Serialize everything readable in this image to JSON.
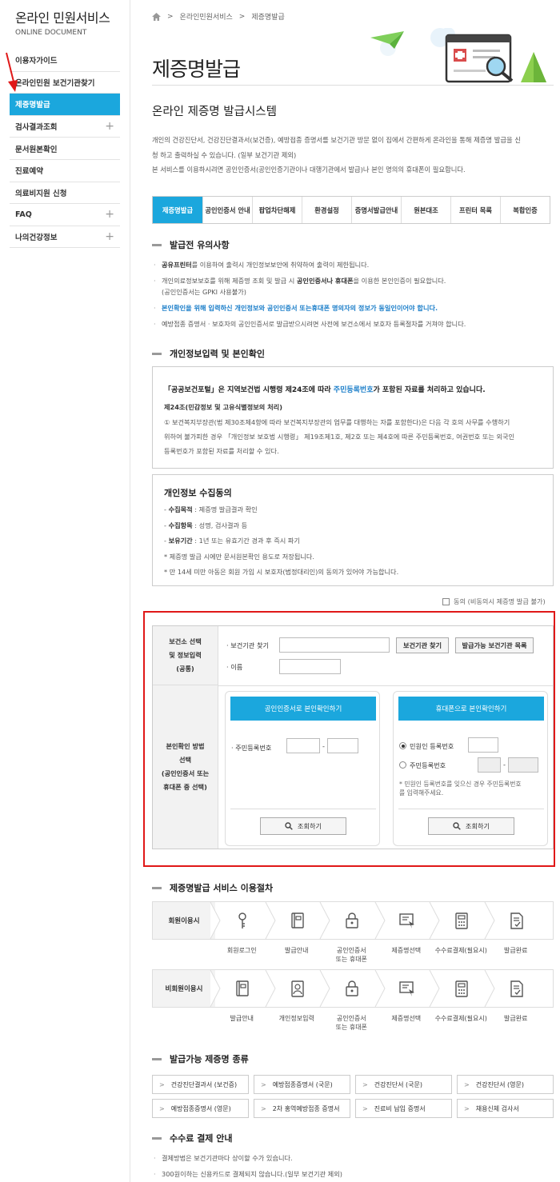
{
  "sidebar": {
    "title": "온라인 민원서비스",
    "subtitle": "ONLINE DOCUMENT",
    "items": [
      {
        "label": "이용자가이드",
        "plus": false,
        "active": false
      },
      {
        "label": "온라인민원 보건기관찾기",
        "plus": false,
        "active": false
      },
      {
        "label": "제증명발급",
        "plus": false,
        "active": true
      },
      {
        "label": "검사결과조회",
        "plus": true,
        "active": false
      },
      {
        "label": "문서원본확인",
        "plus": false,
        "active": false
      },
      {
        "label": "진료예약",
        "plus": false,
        "active": false
      },
      {
        "label": "의료비지원 신청",
        "plus": false,
        "active": false
      },
      {
        "label": "FAQ",
        "plus": true,
        "active": false
      },
      {
        "label": "나의건강정보",
        "plus": true,
        "active": false
      }
    ],
    "plus_symbol": "+"
  },
  "breadcrumb": {
    "home_icon": "home-icon",
    "sep": ">",
    "level1": "온라인민원서비스",
    "level2": "제증명발급"
  },
  "page_title": "제증명발급",
  "system_title": "온라인 제증명 발급시스템",
  "intro": {
    "line1": "개인의 건강진단서, 건강진단결과서(보건증), 예방접종 증명서를 보건기관 방문 없이 집에서 간편하게 온라인을 통해 제증명 발급을 신",
    "line2": "청 하고 출력하실 수 있습니다. (일부 보건기관 제외)",
    "line3": "본 서비스를 이용하시려면 공인인증서(공인인증기관이나 대행기관에서 발급)나 본인 명의의 휴대폰이 필요합니다."
  },
  "tabs": [
    "제증명발급",
    "공인인증서 안내",
    "팝업차단해제",
    "환경설정",
    "증명서발급안내",
    "원본대조",
    "프린터 목록",
    "복합인증"
  ],
  "notice": {
    "heading": "발급전 유의사항",
    "b1_bold": "공유프린터",
    "b1_rest": "를 이용하여 출력시 개인정보보안에 취약하여 출력이 제한됩니다.",
    "b2_pre": "개인의료정보보호를 위해 제증명 조회 및 발급 시 ",
    "b2_bold": "공인인증서나 휴대폰",
    "b2_post": "을 이용한 본인인증이 필요합니다.",
    "b2_line2": "(공인인증서는 GPKI 사용불가)",
    "b3": "본인확인을 위해 입력하신 개인정보와 공인인증서 또는휴대폰 명의자의 정보가 동일인이어야 합니다.",
    "b4": "예방접종 증명서 · 보호자의 공인인증서로 발급받으시려면 사전에 보건소에서 보호자 등록절차를 거쳐야 합니다."
  },
  "personal": {
    "heading": "개인정보입력 및 본인확인",
    "lead_pre": "「공공보건포털」은 지역보건법 시행령 제24조에 따라 ",
    "lead_link": "주민등록번호",
    "lead_post": "가 포함된 자료를 처리하고 있습니다.",
    "article": "제24조(민감정보 및 고유식별정보의 처리)",
    "art_l1": "① 보건복지부장관(법 제30조제4항에 따라 보건복지부장관의 업무를 대행하는 자를 포함한다)은 다음 각 호의 사무를 수행하기",
    "art_l2": "위하여 불가피한 경우 「개인정보 보호법 시행령」 제19조제1호, 제2호 또는 제4호에 따른 주민등록번호, 여권번호 또는 외국인",
    "art_l3": "등록번호가 포함된 자료를 처리할 수 있다."
  },
  "consent": {
    "title": "개인정보 수집동의",
    "purpose_label": "수집목적",
    "purpose": " : 제증명 발급결과 확인",
    "items_label": "수집항목",
    "items": " : 성명, 검사결과 등",
    "period_label": "보유기간",
    "period": " : 1년 또는 유효기간 경과 후 즉시 파기",
    "note1": "* 제증명 발급 시에만 문서원본확인 용도로 저장됩니다.",
    "note2": "* 만 14세 미만 아동은 회원 가입 시 보호자(법정대리인)의 동의가 있어야 가능합니다.",
    "agree": "동의 (비동의시 제증명 발급 불가)"
  },
  "form": {
    "row1_l1": "보건소 선택",
    "row1_l2": "및 정보입력",
    "row1_l3": "(공통)",
    "find_label": "· 보건기관 찾기",
    "find_btn": "보건기관 찾기",
    "list_btn": "발급가능 보건기관 목록",
    "name_label": "· 이름",
    "row2_l1": "본인확인 방법",
    "row2_l2": "선택",
    "row2_l3": "(공인인증서 또는",
    "row2_l4": "휴대폰 중 선택)",
    "cert_btn": "공인인증서로 본인확인하기",
    "rrn_label": "· 주민등록번호",
    "dash": "-",
    "phone_btn": "휴대폰으로 본인확인하기",
    "civil_reg": "민원인 등록번호",
    "rrn2": "주민등록번호",
    "phone_note1": "* 민원인 등록번호를 잊으신 경우 주민등록번호",
    "phone_note2": "를 입력해주세요.",
    "search_btn": "조회하기"
  },
  "procedure": {
    "heading": "제증명발급 서비스 이용절차",
    "member": "회원이용시",
    "member_steps": [
      "회원로그인",
      "발급안내",
      "공인인증서\n또는 휴대폰",
      "제증명선택",
      "수수료결제(필요시)",
      "발급완료"
    ],
    "nonmember": "비회원이용시",
    "nonmember_steps": [
      "발급안내",
      "개인정보입력",
      "공인인증서\n또는 휴대폰",
      "제증명선택",
      "수수료결제(필요시)",
      "발급완료"
    ]
  },
  "docs": {
    "heading": "발급가능 제증명 종류",
    "items": [
      "건강진단결과서 (보건증)",
      "예방접종증명서 (국문)",
      "건강진단서 (국문)",
      "건강진단서 (영문)",
      "예방접종증명서 (영문)",
      "2차 홍역예방접종 증명서",
      "진료비 납입 증명서",
      "채용신체 검사서"
    ]
  },
  "fee": {
    "heading": "수수료 결제 안내",
    "l1": "결제방법은 보건기관마다 상이할 수가 있습니다.",
    "l2": "300원이하는 신용카드로 결제되지 않습니다.(일부 보건기관 제외)"
  },
  "colors": {
    "accent": "#1ba7dd",
    "highlight": "#e01818",
    "link": "#1b7ec9"
  }
}
